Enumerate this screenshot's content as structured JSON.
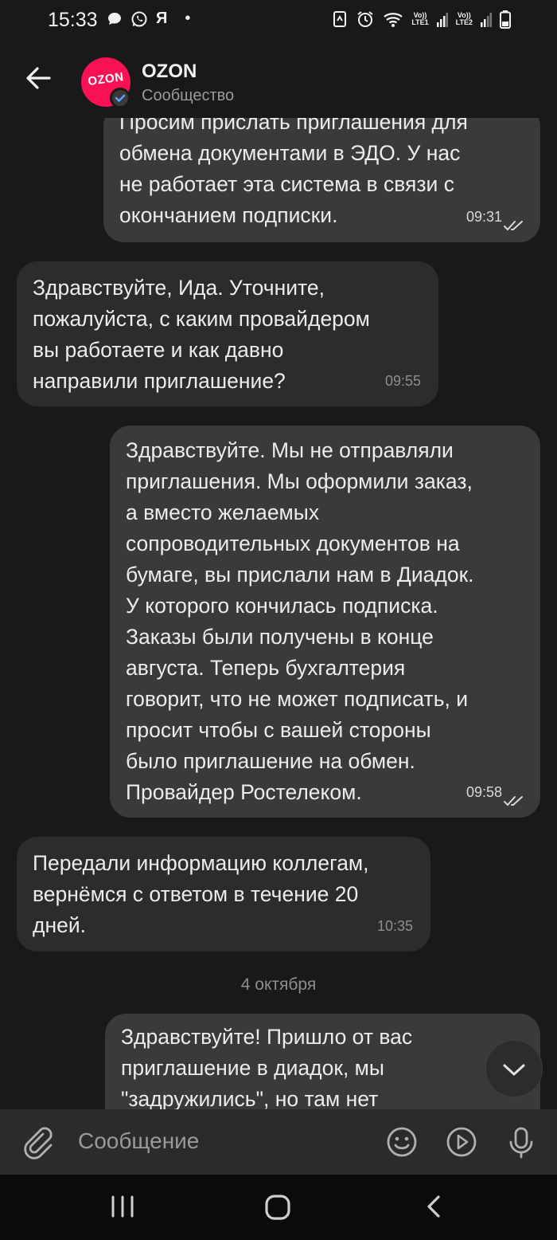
{
  "status_bar": {
    "time": "15:33",
    "left_icons": [
      "chat-bubble-icon",
      "whatsapp-icon",
      "yandex-icon",
      "dot"
    ],
    "yandex_glyph": "Я",
    "dot_glyph": "•",
    "sim1_label": "Vo)) LTE1",
    "sim2_label": "Vo)) LTE2"
  },
  "header": {
    "title": "OZON",
    "subtitle": "Сообщество",
    "avatar_text": "OZON",
    "avatar_color": "#f91155"
  },
  "messages": [
    {
      "side": "out",
      "text": "Просим прислать приглашения для\nобмена документами в ЭДО. У нас\nне работает эта система в связи с\nокончанием подписки.",
      "time": "09:31",
      "read": true
    },
    {
      "side": "in",
      "text": "Здравствуйте, Ида. Уточните,\nпожалуйста, с каким провайдером\nвы работаете и как давно\nнаправили приглашение?",
      "time": "09:55"
    },
    {
      "side": "out",
      "text": "Здравствуйте. Мы не отправляли\nприглашения. Мы оформили заказ,\nа вместо желаемых\nсопроводительных документов на\nбумаге, вы прислали нам в Диадок.\nУ которого кончилась подписка.\nЗаказы были получены в конце\nавгуста. Теперь бухгалтерия\nговорит, что не может подписать, и\nпросит чтобы с вашей стороны\nбыло приглашение на обмен.\nПровайдер Ростелеком.",
      "time": "09:58",
      "read": true
    },
    {
      "side": "in",
      "text": "Передали информацию коллегам,\nвернёмся с ответом в течение 20\nдней.",
      "time": "10:35"
    },
    {
      "side": "out",
      "text": "Здравствуйте! Пришло от вас\nприглашение в диадок, мы\n\"задружились\", но там нет",
      "time": ""
    }
  ],
  "date_separator": "4 октября",
  "composer": {
    "placeholder": "Сообщение"
  },
  "colors": {
    "background": "#191919",
    "outgoing_bubble": "#3a3a3c",
    "incoming_bubble": "#2c2c2e"
  }
}
